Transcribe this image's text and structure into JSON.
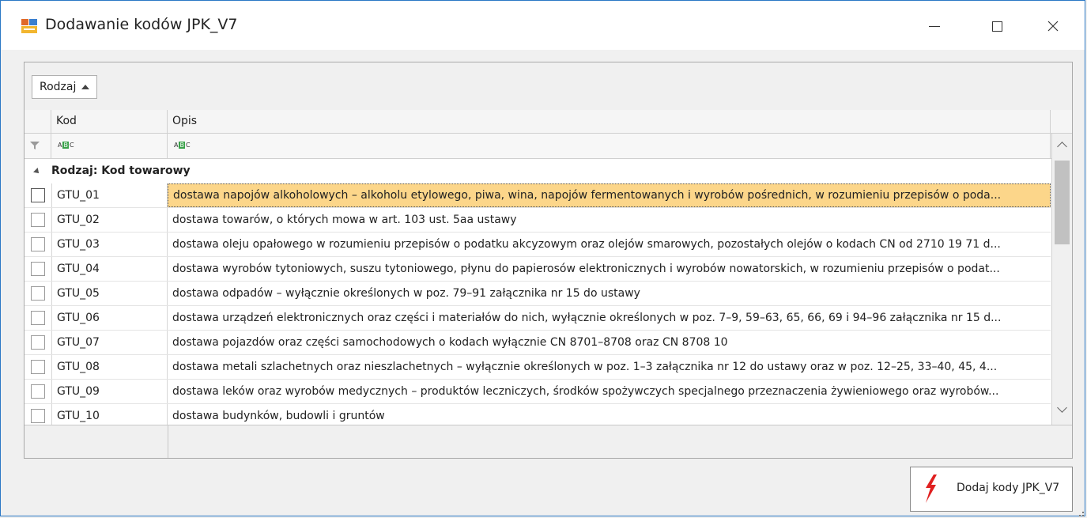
{
  "window": {
    "title": "Dodawanie kodów JPK_V7"
  },
  "group_panel": {
    "chip_label": "Rodzaj"
  },
  "columns": {
    "kod": "Kod",
    "opis": "Opis"
  },
  "group": {
    "label": "Rodzaj: Kod towarowy"
  },
  "rows": [
    {
      "kod": "GTU_01",
      "opis": "dostawa napojów alkoholowych – alkoholu etylowego, piwa, wina, napojów fermentowanych i wyrobów pośrednich, w rozumieniu przepisów o poda...",
      "selected": true
    },
    {
      "kod": "GTU_02",
      "opis": "dostawa towarów, o których mowa w art. 103 ust. 5aa ustawy"
    },
    {
      "kod": "GTU_03",
      "opis": "dostawa oleju opałowego w rozumieniu przepisów o podatku akcyzowym oraz olejów smarowych, pozostałych olejów o kodach CN od 2710 19 71 d..."
    },
    {
      "kod": "GTU_04",
      "opis": "dostawa wyrobów tytoniowych, suszu tytoniowego, płynu do papierosów elektronicznych i wyrobów nowatorskich, w rozumieniu przepisów o podat..."
    },
    {
      "kod": "GTU_05",
      "opis": "dostawa odpadów – wyłącznie określonych w poz. 79–91 załącznika nr 15 do ustawy"
    },
    {
      "kod": "GTU_06",
      "opis": "dostawa urządzeń elektronicznych oraz części i materiałów do nich, wyłącznie określonych w poz. 7–9, 59–63, 65, 66, 69 i 94–96 załącznika nr 15 d..."
    },
    {
      "kod": "GTU_07",
      "opis": "dostawa pojazdów oraz części samochodowych o kodach wyłącznie CN 8701–8708 oraz CN 8708 10"
    },
    {
      "kod": "GTU_08",
      "opis": "dostawa metali szlachetnych oraz nieszlachetnych – wyłącznie określonych w poz. 1–3 załącznika nr 12 do ustawy oraz w poz. 12–25, 33–40, 45, 4..."
    },
    {
      "kod": "GTU_09",
      "opis": "dostawa leków oraz wyrobów medycznych – produktów leczniczych, środków spożywczych specjalnego przeznaczenia żywieniowego oraz wyrobów..."
    },
    {
      "kod": "GTU_10",
      "opis": "dostawa budynków, budowli i gruntów"
    }
  ],
  "action": {
    "label": "Dodaj kody JPK_V7"
  },
  "colors": {
    "selection": "#fcd68a",
    "border_accent": "#2b78c5",
    "bolt": "#e02020"
  },
  "icons": {
    "app": "app-form-icon",
    "sort": "sort-ascending-icon",
    "filter": "filter-funnel-icon",
    "text_filter": "text-filter-abc-icon",
    "action": "lightning-bolt-icon"
  }
}
